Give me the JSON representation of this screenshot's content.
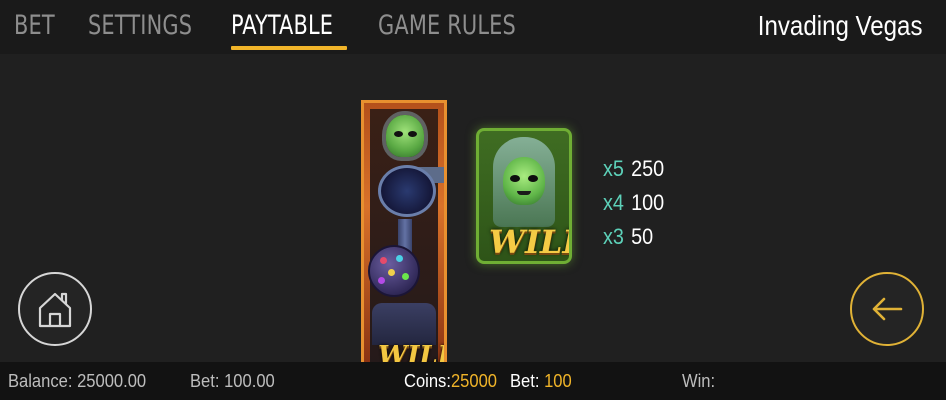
{
  "nav": {
    "tabs": [
      {
        "label": "BET"
      },
      {
        "label": "SETTINGS"
      },
      {
        "label": "PAYTABLE"
      },
      {
        "label": "GAME RULES"
      }
    ],
    "active_tab": "PAYTABLE",
    "game_title": "Invading Vegas"
  },
  "paytable": {
    "symbol_label": "WILD",
    "reel_label": "WILD",
    "payouts": [
      {
        "multiplier": "x5",
        "amount": "250"
      },
      {
        "multiplier": "x4",
        "amount": "100"
      },
      {
        "multiplier": "x3",
        "amount": "50"
      }
    ]
  },
  "icons": {
    "home": "home-icon",
    "back": "arrow-left-icon"
  },
  "status": {
    "balance_label": "Balance:",
    "balance_value": "25000.00",
    "bet_label": "Bet:",
    "bet_value": "100.00",
    "coins_label": "Coins:",
    "coins_value": "25000",
    "coin_bet_label": "Bet:",
    "coin_bet_value": "100",
    "win_label": "Win:",
    "win_value": ""
  },
  "colors": {
    "accent": "#f0b429",
    "multiplier": "#5dd1b9",
    "background": "#1f1f1f"
  }
}
